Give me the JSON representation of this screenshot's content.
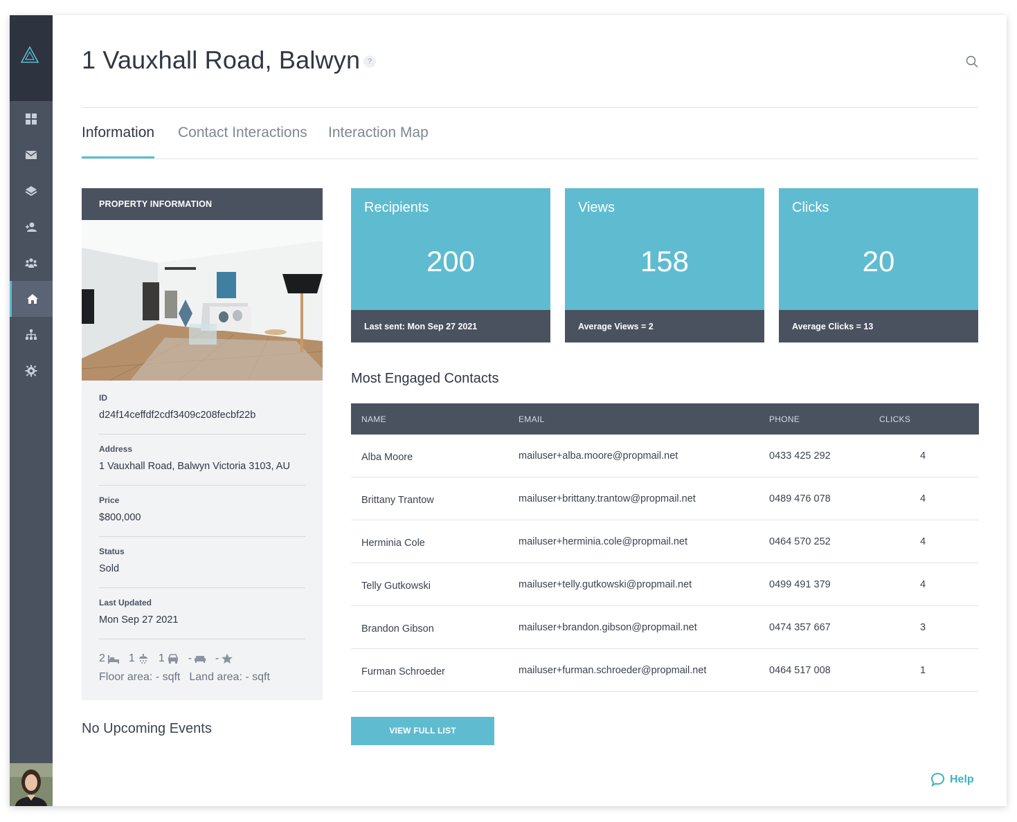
{
  "page": {
    "title": "1 Vauxhall Road, Balwyn",
    "help_badge": "?"
  },
  "sidebar": {
    "items": [
      {
        "icon": "dashboard-icon"
      },
      {
        "icon": "mail-icon"
      },
      {
        "icon": "layers-icon"
      },
      {
        "icon": "contacts-icon"
      },
      {
        "icon": "groups-icon"
      },
      {
        "icon": "home-icon",
        "active": true
      },
      {
        "icon": "org-chart-icon"
      },
      {
        "icon": "gear-icon"
      }
    ]
  },
  "tabs": [
    {
      "label": "Information",
      "active": true
    },
    {
      "label": "Contact Interactions"
    },
    {
      "label": "Interaction Map"
    }
  ],
  "property": {
    "header": "PROPERTY INFORMATION",
    "fields": [
      {
        "label": "ID",
        "value": "d24f14ceffdf2cdf3409c208fecbf22b"
      },
      {
        "label": "Address",
        "value": "1 Vauxhall Road, Balwyn Victoria 3103, AU"
      },
      {
        "label": "Price",
        "value": "$800,000"
      },
      {
        "label": "Status",
        "value": "Sold"
      },
      {
        "label": "Last Updated",
        "value": "Mon Sep 27 2021"
      }
    ],
    "features": {
      "bedrooms": "2",
      "bathrooms": "1",
      "cars": "1",
      "living": "-",
      "rating": "-"
    },
    "floor_area": "Floor area: - sqft",
    "land_area": "Land area: - sqft"
  },
  "events": {
    "empty_text": "No Upcoming Events"
  },
  "stats": [
    {
      "title": "Recipients",
      "value": "200",
      "footer": "Last sent: Mon Sep 27 2021"
    },
    {
      "title": "Views",
      "value": "158",
      "footer": "Average Views = 2"
    },
    {
      "title": "Clicks",
      "value": "20",
      "footer": "Average Clicks = 13"
    }
  ],
  "contacts": {
    "title": "Most Engaged Contacts",
    "columns": [
      "NAME",
      "EMAIL",
      "PHONE",
      "CLICKS"
    ],
    "rows": [
      {
        "name": "Alba Moore",
        "email": "mailuser+alba.moore@propmail.net",
        "phone": "0433 425 292",
        "clicks": "4"
      },
      {
        "name": "Brittany Trantow",
        "email": "mailuser+brittany.trantow@propmail.net",
        "phone": "0489 476 078",
        "clicks": "4"
      },
      {
        "name": "Herminia Cole",
        "email": "mailuser+herminia.cole@propmail.net",
        "phone": "0464 570 252",
        "clicks": "4"
      },
      {
        "name": "Telly Gutkowski",
        "email": "mailuser+telly.gutkowski@propmail.net",
        "phone": "0499 491 379",
        "clicks": "4"
      },
      {
        "name": "Brandon Gibson",
        "email": "mailuser+brandon.gibson@propmail.net",
        "phone": "0474 357 667",
        "clicks": "3"
      },
      {
        "name": "Furman Schroeder",
        "email": "mailuser+furman.schroeder@propmail.net",
        "phone": "0464 517 008",
        "clicks": "1"
      }
    ],
    "button": "VIEW FULL LIST"
  },
  "help": {
    "label": "Help"
  },
  "colors": {
    "accent": "#5fbcd0",
    "sidebar": "#4a5260",
    "sidebar_dark": "#2d3440",
    "help": "#3bb3c4"
  }
}
